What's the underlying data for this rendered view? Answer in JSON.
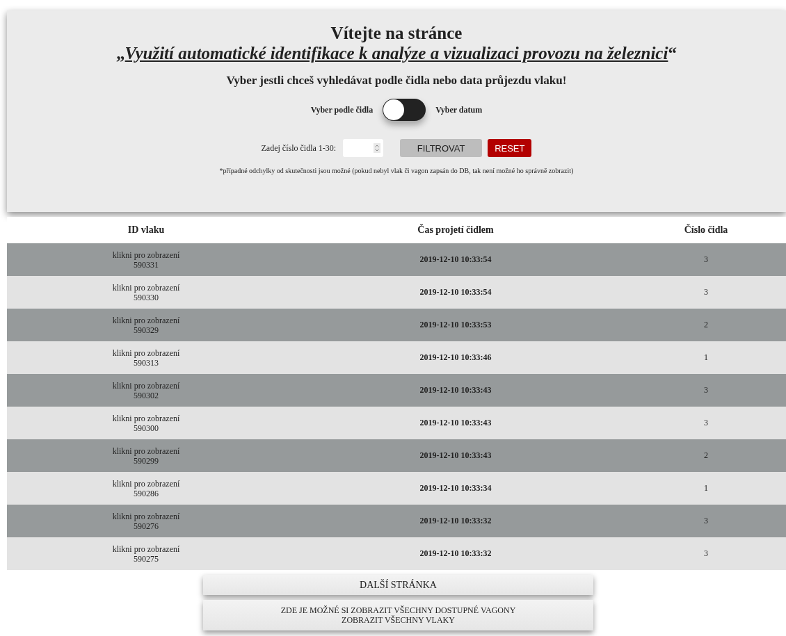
{
  "header": {
    "title": "Vítejte na stránce",
    "quote_open": "„",
    "project_link": "Využití automatické identifikace k analýze a vizualizaci provozu na železnici",
    "quote_close": "“",
    "subtitle": "Vyber jestli chceš vyhledávat podle čidla nebo data průjezdu vlaku!"
  },
  "toggle": {
    "left_label": "Vyber podle čidla",
    "right_label": "Vyber datum",
    "on": false
  },
  "filter": {
    "label": "Zadej číslo čidla 1-30:",
    "filter_button": "FILTROVAT",
    "reset_button": "RESET"
  },
  "note": "*případné odchylky od skutečnosti jsou možné (pokud nebyl vlak či vagon zapsán do DB, tak není možné ho správně zobrazit)",
  "table": {
    "columns": [
      "ID vlaku",
      "Čas projetí čidlem",
      "Číslo čidla"
    ],
    "rows": [
      {
        "link": "klikni pro zobrazení",
        "id": "590331",
        "time": "2019-12-10 10:33:54",
        "sensor": "3"
      },
      {
        "link": "klikni pro zobrazení",
        "id": "590330",
        "time": "2019-12-10 10:33:54",
        "sensor": "3"
      },
      {
        "link": "klikni pro zobrazení",
        "id": "590329",
        "time": "2019-12-10 10:33:53",
        "sensor": "2"
      },
      {
        "link": "klikni pro zobrazení",
        "id": "590313",
        "time": "2019-12-10 10:33:46",
        "sensor": "1"
      },
      {
        "link": "klikni pro zobrazení",
        "id": "590302",
        "time": "2019-12-10 10:33:43",
        "sensor": "3"
      },
      {
        "link": "klikni pro zobrazení",
        "id": "590300",
        "time": "2019-12-10 10:33:43",
        "sensor": "3"
      },
      {
        "link": "klikni pro zobrazení",
        "id": "590299",
        "time": "2019-12-10 10:33:43",
        "sensor": "2"
      },
      {
        "link": "klikni pro zobrazení",
        "id": "590286",
        "time": "2019-12-10 10:33:34",
        "sensor": "1"
      },
      {
        "link": "klikni pro zobrazení",
        "id": "590276",
        "time": "2019-12-10 10:33:32",
        "sensor": "3"
      },
      {
        "link": "klikni pro zobrazení",
        "id": "590275",
        "time": "2019-12-10 10:33:32",
        "sensor": "3"
      }
    ]
  },
  "footer": {
    "next_page": "DALŠÍ STRÁNKA",
    "links": [
      "ZDE JE MOŽNÉ SI ZOBRAZIT VŠECHNY DOSTUPNÉ VAGONY",
      "ZOBRAZIT VŠECHNY VLAKY"
    ]
  }
}
